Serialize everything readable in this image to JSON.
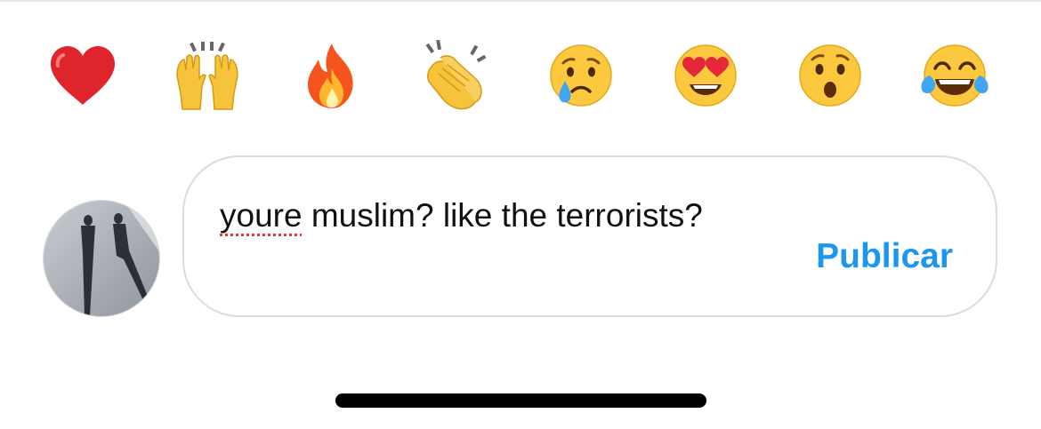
{
  "reactions": [
    {
      "icon": "red-heart-icon",
      "label": "❤️"
    },
    {
      "icon": "raising-hands-icon",
      "label": "🙌"
    },
    {
      "icon": "fire-icon",
      "label": "🔥"
    },
    {
      "icon": "clapping-hands-icon",
      "label": "👏"
    },
    {
      "icon": "crying-face-icon",
      "label": "😢"
    },
    {
      "icon": "heart-eyes-face-icon",
      "label": "😍"
    },
    {
      "icon": "surprised-face-icon",
      "label": "😮"
    },
    {
      "icon": "tears-of-joy-face-icon",
      "label": "😂"
    }
  ],
  "comment": {
    "misspelled_word": "youre",
    "text_rest": " muslim? like the terrorists?",
    "publish_label": "Publicar"
  },
  "colors": {
    "accent": "#1c97f0",
    "border": "#dbdbdb",
    "spellcheck": "#e03a3a"
  }
}
